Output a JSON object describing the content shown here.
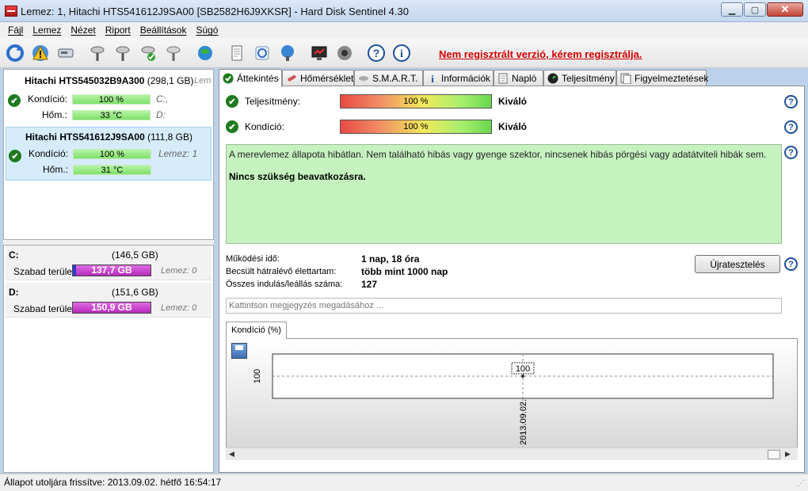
{
  "window": {
    "title": "Lemez: 1, Hitachi HTS541612J9SA00 [SB2582H6J9XKSR]  -  Hard Disk Sentinel 4.30",
    "minimize": "▁",
    "maximize": "▢",
    "close": "✕"
  },
  "menu": [
    "Fájl",
    "Lemez",
    "Nézet",
    "Riport",
    "Beállítások",
    "Súgó"
  ],
  "toolbar": {
    "register_text": "Nem regisztrált verzió, kérem regisztrálja."
  },
  "disks": [
    {
      "name": "Hitachi HTS545032B9A300",
      "size": "(298,1 GB)",
      "extra": "Lem",
      "condition_label": "Kondíció:",
      "condition_value": "100 %",
      "condition_side": "C:,",
      "temp_label": "Hőm.:",
      "temp_value": "33 °C",
      "temp_side": "D:"
    },
    {
      "name": "Hitachi HTS541612J9SA00",
      "size": "(111,8 GB)",
      "condition_label": "Kondíció:",
      "condition_value": "100 %",
      "condition_side": "Lemez: 1",
      "temp_label": "Hőm.:",
      "temp_value": "31 °C"
    }
  ],
  "volumes": [
    {
      "letter": "C:",
      "size": "(146,5 GB)",
      "free_label": "Szabad terület",
      "free_value": "137,7 GB",
      "disk": "Lemez: 0"
    },
    {
      "letter": "D:",
      "size": "(151,6 GB)",
      "free_label": "Szabad terület",
      "free_value": "150,9 GB",
      "disk": "Lemez: 0"
    }
  ],
  "tabs": [
    "Áttekintés",
    "Hőmérséklet",
    "S.M.A.R.T.",
    "Információk",
    "Napló",
    "Teljesítmény",
    "Figyelmeztetések"
  ],
  "overview": {
    "performance_label": "Teljesítmény:",
    "performance_value": "100 %",
    "performance_rating": "Kiváló",
    "condition_label": "Kondíció:",
    "condition_value": "100 %",
    "condition_rating": "Kiváló",
    "description": "A merevlemez állapota hibátlan. Nem található hibás vagy gyenge szektor, nincsenek hibás pörgési vagy adatátviteli hibák sem.",
    "advice": "Nincs szükség beavatkozásra.",
    "uptime_label": "Működési idő:",
    "uptime_value": "1 nap, 18 óra",
    "lifetime_label": "Becsült hátralévő élettartam:",
    "lifetime_value": "több mint 1000 nap",
    "startstop_label": "Összes indulás/leállás száma:",
    "startstop_value": "127",
    "retest_button": "Újratesztelés",
    "note_placeholder": "Kattintson megjegyzés megadásához ...",
    "help": "?"
  },
  "graph": {
    "tab_label": "Kondíció  (%)",
    "y_tick": "100",
    "point_label": "100",
    "date_label": "2013.09.02."
  },
  "chart_data": {
    "type": "line",
    "x": [
      "2013.09.02."
    ],
    "series": [
      {
        "values": [
          100
        ]
      }
    ],
    "ylabel": "",
    "xlabel": ""
  },
  "statusbar": {
    "text": "Állapot utoljára frissítve: 2013.09.02. hétfő 16:54:17"
  }
}
